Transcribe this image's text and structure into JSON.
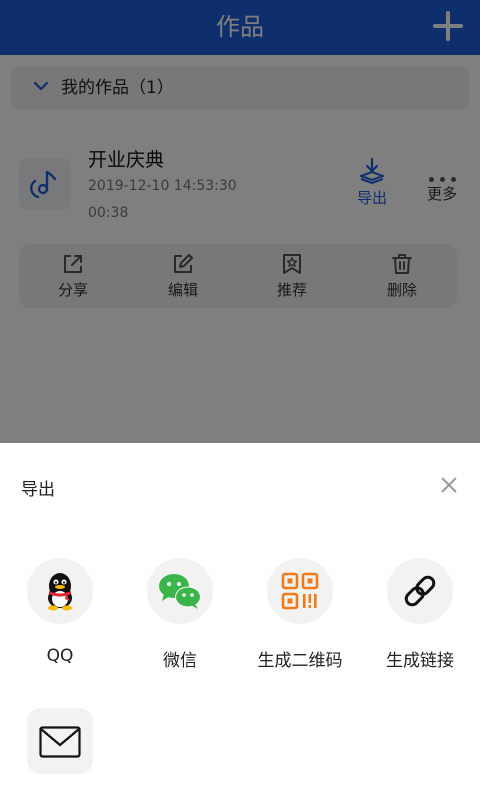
{
  "header": {
    "title": "作品",
    "add_icon": "plus-icon"
  },
  "section": {
    "label": "我的作品（1）",
    "icon": "chevron-down-icon"
  },
  "work": {
    "title": "开业庆典",
    "date": "2019-12-10 14:53:30",
    "duration": "00:38",
    "thumb_icon": "music-note-icon",
    "export_label": "导出",
    "more_label": "更多"
  },
  "actions": [
    {
      "label": "分享",
      "icon": "share-icon"
    },
    {
      "label": "编辑",
      "icon": "edit-icon"
    },
    {
      "label": "推荐",
      "icon": "recommend-icon"
    },
    {
      "label": "删除",
      "icon": "trash-icon"
    }
  ],
  "sheet": {
    "title": "导出",
    "close_icon": "close-icon",
    "options": [
      {
        "label": "QQ",
        "icon": "qq-icon"
      },
      {
        "label": "微信",
        "icon": "wechat-icon"
      },
      {
        "label": "生成二维码",
        "icon": "qrcode-icon"
      },
      {
        "label": "生成链接",
        "icon": "link-icon"
      }
    ],
    "email_icon": "mail-icon"
  },
  "colors": {
    "brand": "#1e5fd8",
    "overlay": "rgba(0,0,0,0.5)",
    "wechat_green": "#3bb54a",
    "qrcode_orange": "#f07a1a"
  }
}
